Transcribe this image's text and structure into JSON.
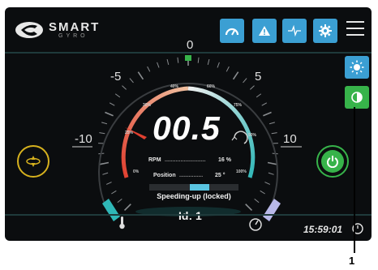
{
  "brand": {
    "title": "SMART",
    "subtitle": "GYRO"
  },
  "toolbar": {
    "buttons": [
      {
        "name": "speedometer-button",
        "icon": "gauge-icon"
      },
      {
        "name": "warning-button",
        "icon": "warning-icon"
      },
      {
        "name": "waveform-button",
        "icon": "waveform-icon"
      },
      {
        "name": "settings-button",
        "icon": "gear-icon"
      }
    ],
    "menu_icon": "hamburger-icon"
  },
  "side": {
    "brightness_icon": "brightness-icon",
    "contrast_icon": "contrast-icon"
  },
  "gauge": {
    "value": "00.5",
    "scale": {
      "min": "-10",
      "neg_mid": "-5",
      "zero": "0",
      "pos_mid": "5",
      "max": "10"
    },
    "percent_ticks": [
      "0%",
      "25%",
      "30%",
      "40%",
      "60%",
      "75%",
      "90%",
      "100%"
    ],
    "needle_value": 0.5
  },
  "info": {
    "rpm_label": "RPM",
    "rpm_dots": "..........................",
    "rpm_value": "16 %",
    "position_label": "Position",
    "position_dots": "...............",
    "position_value": "25 °",
    "status": "Speeding-up (locked)",
    "id": "Id: 1"
  },
  "clock": {
    "time": "15:59:01"
  },
  "annotation": {
    "number": "1"
  },
  "colors": {
    "accent_blue": "#3b9fd3",
    "accent_green": "#37b34a",
    "ring_gold": "#d6b11e",
    "arc_red": "#e04030",
    "arc_orange": "#e08050",
    "arc_teal": "#2fb7b7"
  }
}
